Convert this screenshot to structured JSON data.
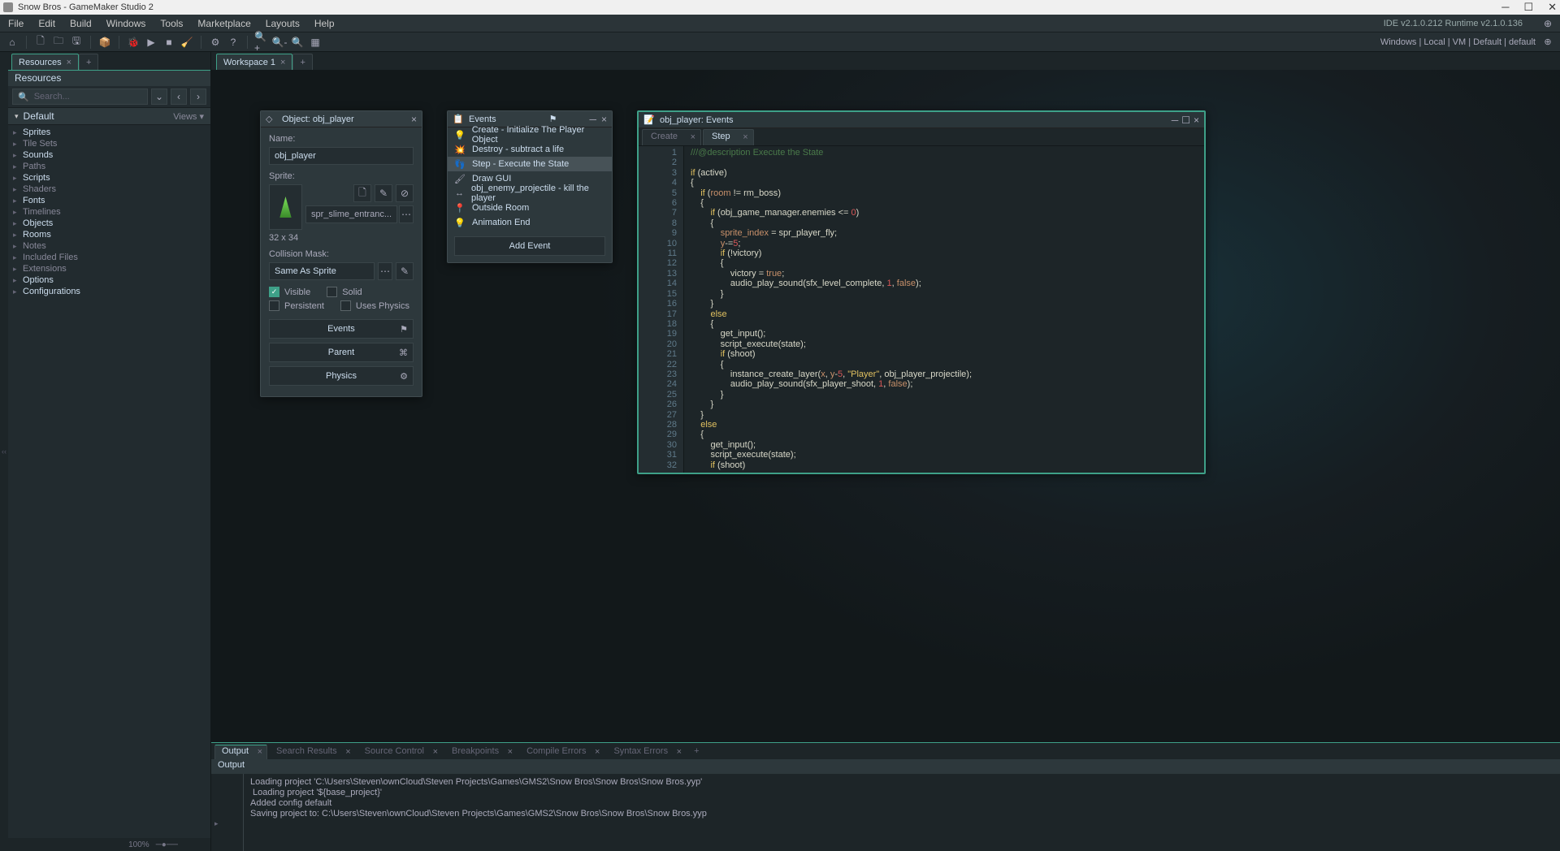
{
  "titlebar": {
    "title": "Snow Bros - GameMaker Studio 2"
  },
  "menubar": {
    "items": [
      "File",
      "Edit",
      "Build",
      "Windows",
      "Tools",
      "Marketplace",
      "Layouts",
      "Help"
    ],
    "runtime": "IDE v2.1.0.212 Runtime v2.1.0.136"
  },
  "toolbar": {
    "right_text": "Windows  |  Local  |  VM  |  Default  |  default"
  },
  "resources": {
    "tab_label": "Resources",
    "header": "Resources",
    "search_placeholder": "Search...",
    "default_label": "Default",
    "views_label": "Views ▾",
    "tree": [
      {
        "label": "Sprites",
        "bright": true
      },
      {
        "label": "Tile Sets",
        "bright": false
      },
      {
        "label": "Sounds",
        "bright": true
      },
      {
        "label": "Paths",
        "bright": false
      },
      {
        "label": "Scripts",
        "bright": true
      },
      {
        "label": "Shaders",
        "bright": false
      },
      {
        "label": "Fonts",
        "bright": true
      },
      {
        "label": "Timelines",
        "bright": false
      },
      {
        "label": "Objects",
        "bright": true
      },
      {
        "label": "Rooms",
        "bright": true
      },
      {
        "label": "Notes",
        "bright": false
      },
      {
        "label": "Included Files",
        "bright": false
      },
      {
        "label": "Extensions",
        "bright": false
      },
      {
        "label": "Options",
        "bright": true
      },
      {
        "label": "Configurations",
        "bright": true
      }
    ],
    "zoom": "100%"
  },
  "workspace": {
    "tab_label": "Workspace 1"
  },
  "object_window": {
    "title": "Object: obj_player",
    "name_label": "Name:",
    "name_value": "obj_player",
    "sprite_label": "Sprite:",
    "sprite_name": "spr_slime_entranc...",
    "dimensions": "32 x 34",
    "mask_label": "Collision Mask:",
    "mask_value": "Same As Sprite",
    "visible": "Visible",
    "solid": "Solid",
    "persistent": "Persistent",
    "uses_physics": "Uses Physics",
    "btn_events": "Events",
    "btn_parent": "Parent",
    "btn_physics": "Physics"
  },
  "events_window": {
    "title": "Events",
    "items": [
      "Create - Initialize The Player Object",
      "Destroy - subtract a life",
      "Step - Execute the State",
      "Draw GUI",
      "obj_enemy_projectile - kill the player",
      "Outside Room",
      "Animation End"
    ],
    "add_label": "Add Event"
  },
  "code_window": {
    "title": "obj_player: Events",
    "tabs": [
      "Create",
      "Step"
    ],
    "line_start": 1,
    "line_end": 32
  },
  "output": {
    "tabs": [
      "Output",
      "Search Results",
      "Source Control",
      "Breakpoints",
      "Compile Errors",
      "Syntax Errors"
    ],
    "header": "Output",
    "lines": [
      "Loading project 'C:\\Users\\Steven\\ownCloud\\Steven Projects\\Games\\GMS2\\Snow Bros\\Snow Bros\\Snow Bros.yyp'",
      " Loading project '${base_project}'",
      "Added config default",
      "Saving project to: C:\\Users\\Steven\\ownCloud\\Steven Projects\\Games\\GMS2\\Snow Bros\\Snow Bros\\Snow Bros.yyp"
    ]
  }
}
